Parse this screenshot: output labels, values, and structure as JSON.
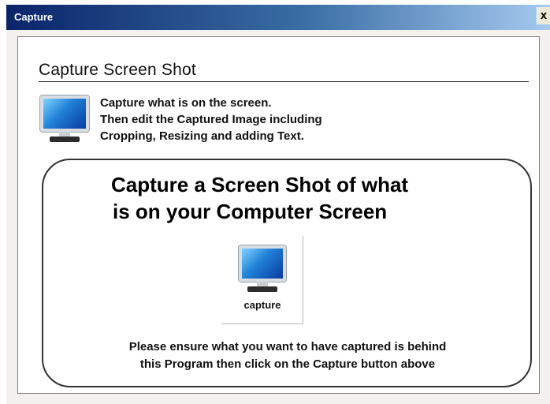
{
  "window": {
    "title": "Capture",
    "close_label": "x"
  },
  "section": {
    "heading": "Capture Screen Shot",
    "description": [
      "Capture what is on the screen.",
      "Then edit the Captured Image including",
      "Cropping,  Resizing and adding Text."
    ]
  },
  "main": {
    "title_lines": [
      "Capture a Screen Shot of what",
      "is on your Computer Screen"
    ],
    "capture_button_label": "capture",
    "instructions": [
      "Please ensure what you want to have captured is behind",
      "this Program then click on the Capture button above"
    ]
  },
  "icons": {
    "header_icon": "monitor-icon",
    "button_icon": "monitor-icon"
  },
  "colors": {
    "titlebar_start": "#0a246a",
    "titlebar_end": "#a6caf0",
    "screen_blue": "#1f7fd6"
  }
}
